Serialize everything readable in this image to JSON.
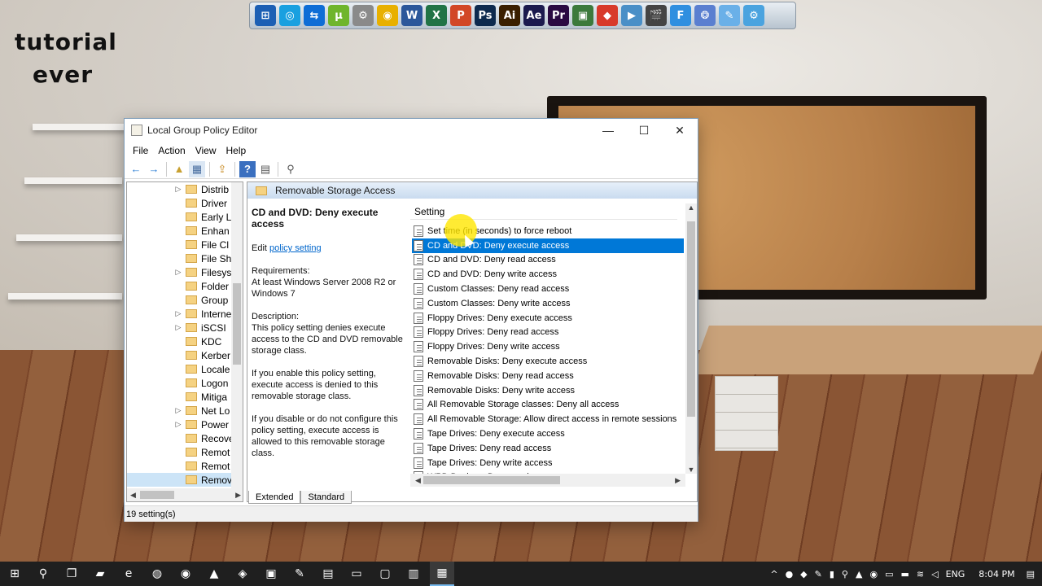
{
  "watermark": {
    "line1": "tutorial",
    "line2": "ever"
  },
  "dock": [
    {
      "name": "windows-orb-icon",
      "glyph": "⊞",
      "color": "#1c5fb4"
    },
    {
      "name": "blue-app-icon",
      "glyph": "◎",
      "color": "#19a0e0"
    },
    {
      "name": "teamviewer-icon",
      "glyph": "⇆",
      "color": "#0e6dd6"
    },
    {
      "name": "utorrent-icon",
      "glyph": "µ",
      "color": "#6fb52c"
    },
    {
      "name": "robot-app-icon",
      "glyph": "⚙",
      "color": "#8a8a8a"
    },
    {
      "name": "chrome-icon",
      "glyph": "◉",
      "color": "#e8b000"
    },
    {
      "name": "word-icon",
      "glyph": "W",
      "color": "#2b579a"
    },
    {
      "name": "excel-icon",
      "glyph": "X",
      "color": "#217346"
    },
    {
      "name": "powerpoint-icon",
      "glyph": "P",
      "color": "#d24726"
    },
    {
      "name": "photoshop-icon",
      "glyph": "Ps",
      "color": "#0d2a4e"
    },
    {
      "name": "illustrator-icon",
      "glyph": "Ai",
      "color": "#3a1f00"
    },
    {
      "name": "after-effects-icon",
      "glyph": "Ae",
      "color": "#1b1a4e"
    },
    {
      "name": "premiere-icon",
      "glyph": "Pr",
      "color": "#2a0a42"
    },
    {
      "name": "camtasia-icon",
      "glyph": "▣",
      "color": "#3c7a3c"
    },
    {
      "name": "colorful-app-icon",
      "glyph": "◆",
      "color": "#d83a2a"
    },
    {
      "name": "video-app-icon",
      "glyph": "▶",
      "color": "#4a8fc7"
    },
    {
      "name": "clapper-icon",
      "glyph": "🎬",
      "color": "#444444"
    },
    {
      "name": "f-app-icon",
      "glyph": "F",
      "color": "#2f8fe0"
    },
    {
      "name": "globe-app-icon",
      "glyph": "❂",
      "color": "#5a7fd0"
    },
    {
      "name": "pen-app-icon",
      "glyph": "✎",
      "color": "#6ab0e8"
    },
    {
      "name": "settings-app-icon",
      "glyph": "⚙",
      "color": "#4aa3df"
    }
  ],
  "window": {
    "title": "Local Group Policy Editor",
    "controls": {
      "minimize": "—",
      "maximize": "☐",
      "close": "✕"
    },
    "menu": [
      "File",
      "Action",
      "View",
      "Help"
    ],
    "toolbar": [
      "←",
      "→",
      "▲",
      "▦",
      "⇪",
      "?",
      "▤",
      "⚲"
    ]
  },
  "tree": {
    "items": [
      {
        "label": "Distrib",
        "expand": "▷"
      },
      {
        "label": "Driver",
        "expand": ""
      },
      {
        "label": "Early L",
        "expand": ""
      },
      {
        "label": "Enhan",
        "expand": ""
      },
      {
        "label": "File Cl",
        "expand": ""
      },
      {
        "label": "File Sh",
        "expand": ""
      },
      {
        "label": "Filesys",
        "expand": "▷"
      },
      {
        "label": "Folder",
        "expand": ""
      },
      {
        "label": "Group",
        "expand": ""
      },
      {
        "label": "Interne",
        "expand": "▷"
      },
      {
        "label": "iSCSI",
        "expand": "▷"
      },
      {
        "label": "KDC",
        "expand": ""
      },
      {
        "label": "Kerber",
        "expand": ""
      },
      {
        "label": "Locale",
        "expand": ""
      },
      {
        "label": "Logon",
        "expand": ""
      },
      {
        "label": "Mitiga",
        "expand": ""
      },
      {
        "label": "Net Lo",
        "expand": "▷"
      },
      {
        "label": "Power",
        "expand": "▷"
      },
      {
        "label": "Recove",
        "expand": ""
      },
      {
        "label": "Remot",
        "expand": ""
      },
      {
        "label": "Remot",
        "expand": ""
      },
      {
        "label": "Remov",
        "expand": "",
        "selected": true
      }
    ]
  },
  "pane": {
    "header": "Removable Storage Access",
    "policy_title": "CD and DVD: Deny execute access",
    "edit_prefix": "Edit ",
    "edit_link": "policy setting",
    "requirements_label": "Requirements:",
    "requirements_text": "At least Windows Server 2008 R2 or Windows 7",
    "description_label": "Description:",
    "description_text": "This policy setting denies execute access to the CD and DVD removable storage class.",
    "enable_text": "If you enable this policy setting, execute access is denied to this removable storage class.",
    "disable_text": "If you disable or do not configure this policy setting, execute access is allowed to this removable storage class."
  },
  "list": {
    "column": "Setting",
    "rows": [
      "Set time (in seconds) to force reboot",
      "CD and DVD: Deny execute access",
      "CD and DVD: Deny read access",
      "CD and DVD: Deny write access",
      "Custom Classes: Deny read access",
      "Custom Classes: Deny write access",
      "Floppy Drives: Deny execute access",
      "Floppy Drives: Deny read access",
      "Floppy Drives: Deny write access",
      "Removable Disks: Deny execute access",
      "Removable Disks: Deny read access",
      "Removable Disks: Deny write access",
      "All Removable Storage classes: Deny all access",
      "All Removable Storage: Allow direct access in remote sessions",
      "Tape Drives: Deny execute access",
      "Tape Drives: Deny read access",
      "Tape Drives: Deny write access",
      "WPD Devices: Deny read access"
    ],
    "selected_index": 1
  },
  "tabs": {
    "extended": "Extended",
    "standard": "Standard"
  },
  "status": "19 setting(s)",
  "taskbar": {
    "apps": [
      {
        "name": "start-icon",
        "glyph": "⊞"
      },
      {
        "name": "search-icon",
        "glyph": "⚲"
      },
      {
        "name": "task-view-icon",
        "glyph": "❐"
      },
      {
        "name": "file-explorer-icon",
        "glyph": "▰"
      },
      {
        "name": "edge-icon",
        "glyph": "e"
      },
      {
        "name": "firefox-icon",
        "glyph": "◍"
      },
      {
        "name": "chrome-icon",
        "glyph": "◉"
      },
      {
        "name": "android-icon",
        "glyph": "▲"
      },
      {
        "name": "cube-app-icon",
        "glyph": "◈"
      },
      {
        "name": "pc-app-icon",
        "glyph": "▣"
      },
      {
        "name": "paint-app-icon",
        "glyph": "✎"
      },
      {
        "name": "notepad-app-icon",
        "glyph": "▤"
      },
      {
        "name": "media-app-icon",
        "glyph": "▭"
      },
      {
        "name": "card-app-icon",
        "glyph": "▢"
      },
      {
        "name": "text-app-icon",
        "glyph": "▥"
      },
      {
        "name": "policy-editor-taskbar-icon",
        "glyph": "▦"
      }
    ],
    "language": "ENG",
    "time": "8:04 PM"
  }
}
